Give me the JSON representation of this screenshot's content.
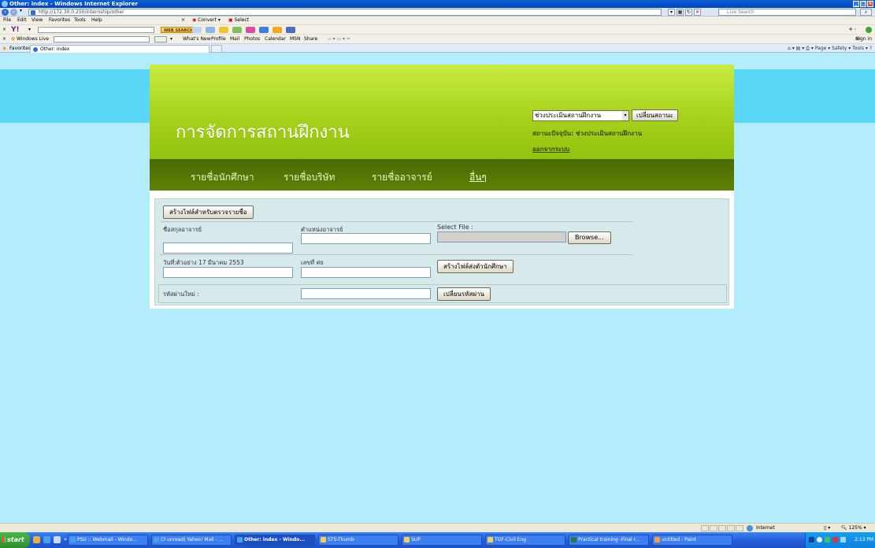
{
  "window": {
    "title": "Other: index - Windows Internet Explorer"
  },
  "address_bar": {
    "url": "http://172.30.0.250/internship/other",
    "search_placeholder": "Live Search"
  },
  "menu": {
    "items": [
      "File",
      "Edit",
      "View",
      "Favorites",
      "Tools",
      "Help"
    ],
    "convert": "Convert",
    "select": "Select"
  },
  "yahoo_toolbar": {
    "logo": "Y!",
    "search_button": "WEB SEARCH"
  },
  "live_toolbar": {
    "label": "Windows Live",
    "links": [
      "What's New",
      "Profile",
      "Mail",
      "Photos",
      "Calendar",
      "MSN",
      "Share"
    ],
    "sign_in": "Sign in"
  },
  "favorites_bar": {
    "favorites": "Favorites",
    "tab_title": "Other: index",
    "commands": "Page ▾  Safety ▾  Tools ▾"
  },
  "site": {
    "title": "การจัดการสถานฝึกงาน",
    "status_select": "ช่วงประเมินสถานฝึกงาน",
    "status_button": "เปลี่ยนสถานะ",
    "current_status": "สถานะปัจจุบัน: ช่วงประเมินสถานฝึกงาน",
    "logout": "ออกจากระบบ",
    "nav": [
      "รายชื่อนักศึกษา",
      "รายชื่อบริษัท",
      "รายชื่ออาจารย์",
      "อื่นๆ"
    ]
  },
  "form": {
    "create_list_button": "สร้างไฟล์สำหรับตรวจรายชื่อ",
    "teacher_name_label": "ชื่อสกุลอาจารย์",
    "teacher_position_label": "ตำแหน่งอาจารย์",
    "select_file_label": "Select File :",
    "browse_button": "Browse...",
    "date_label": "วันที่:ตัวอย่าง 17 มีนาคม 2553",
    "doc_number_label": "เลขที่ ศธ",
    "create_letter_button": "สร้างไฟล์ส่งตัวนักศึกษา",
    "new_password_label": "รหัสผ่านใหม่ :",
    "change_password_button": "เปลี่ยนรหัสผ่าน"
  },
  "statusbar": {
    "zone": "Internet",
    "zoom": "125%"
  },
  "taskbar": {
    "start": "start",
    "buttons": [
      "PSU :: Webmail - Windo...",
      "(3 unread) Yahoo! Mail - ...",
      "Other: index - Windo...",
      "STS-Thumb",
      "SUP",
      "TOF-Civil Eng",
      "Practical training -Final r...",
      "untitled - Paint"
    ],
    "clock": "2:13 PM"
  }
}
